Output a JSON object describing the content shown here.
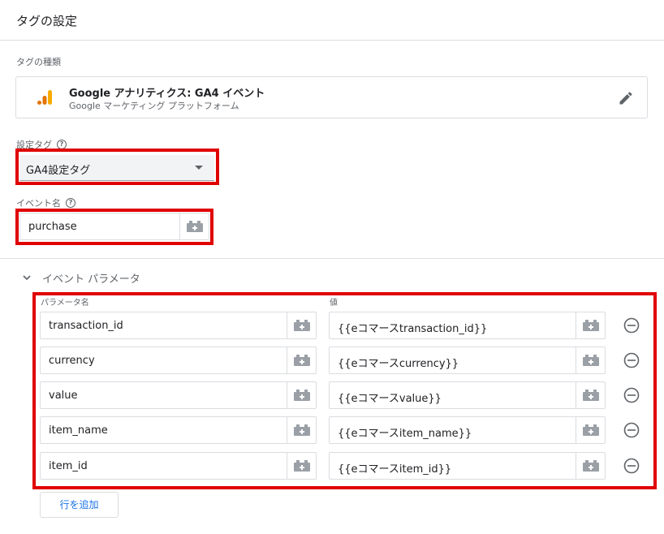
{
  "header": {
    "title": "タグの設定"
  },
  "tag_type": {
    "label": "タグの種類",
    "name": "Google アナリティクス: GA4 イベント",
    "platform": "Google マーケティング プラットフォーム",
    "icon": "google-analytics-icon",
    "edit_icon": "pencil-icon"
  },
  "config_tag": {
    "label": "設定タグ",
    "value": "GA4設定タグ"
  },
  "event_name": {
    "label": "イベント名",
    "value": "purchase"
  },
  "params": {
    "title": "イベント パラメータ",
    "col_name": "パラメータ名",
    "col_value": "値",
    "rows": [
      {
        "name": "transaction_id",
        "value": "{{eコマースtransaction_id}}"
      },
      {
        "name": "currency",
        "value": "{{eコマースcurrency}}"
      },
      {
        "name": "value",
        "value": "{{eコマースvalue}}"
      },
      {
        "name": "item_name",
        "value": "{{eコマースitem_name}}"
      },
      {
        "name": "item_id",
        "value": "{{eコマースitem_id}}"
      }
    ],
    "add_row_label": "行を追加"
  },
  "colors": {
    "highlight": "#e00000",
    "accent": "#1a73e8",
    "ga_orange": "#f9ab00",
    "ga_dark_orange": "#e37400"
  }
}
